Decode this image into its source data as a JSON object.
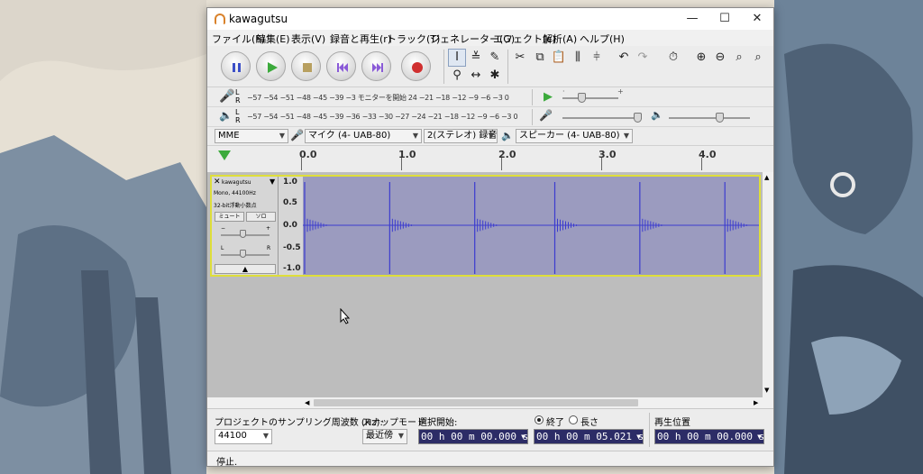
{
  "window": {
    "title": "kawagutsu"
  },
  "menu": [
    "ファイル(F)",
    "編集(E)",
    "表示(V)",
    "録音と再生(r)",
    "トラック(T)",
    "ジェネレーター(G)",
    "エフェクト(c)",
    "解析(A)",
    "ヘルプ(H)"
  ],
  "meters": {
    "record": {
      "channels": [
        "L",
        "R"
      ],
      "scale": "−57 −54 −51 −48 −45   −39 −3 モニターを開始 24 −21 −18   −12 −9  −6  −3  0"
    },
    "playback": {
      "channels": [
        "L",
        "R"
      ],
      "scale": "−57 −54 −51 −48 −45  −39 −36 −33 −30 −27 −24 −21 −18  −12 −9  −6  −3  0"
    },
    "record_volume": 0.35,
    "playback_volume": 0.95,
    "playback_speed": 0.8
  },
  "devices": {
    "host": "MME",
    "input": "マイク (4- UAB-80)",
    "channels": "2(ステレオ) 録音チ",
    "output": "スピーカー (4- UAB-80)"
  },
  "ruler": {
    "labels": [
      "0.0",
      "1.0",
      "2.0",
      "3.0",
      "4.0"
    ]
  },
  "track": {
    "name": "kawagutsu",
    "info1": "Mono, 44100Hz",
    "info2": "32-bit浮動小数点",
    "mute": "ミュート",
    "solo": "ソロ",
    "gain_minus": "−",
    "gain_plus": "+",
    "pan_left": "L",
    "pan_right": "R",
    "scale": [
      "1.0",
      "0.5",
      "0.0",
      "-0.5",
      "-1.0"
    ],
    "clicks": [
      0.0,
      0.85,
      1.7,
      2.5,
      3.35,
      4.2
    ]
  },
  "selection": {
    "rate_label": "プロジェクトのサンプリング周波数 (Hz):",
    "rate_value": "44100",
    "snap_label": "スナップモード",
    "snap_value": "最近傍",
    "start_label": "選択開始:",
    "end_label": "終了",
    "length_label": "長さ",
    "position_label": "再生位置",
    "start_value": "00 h 00 m 00.000 s",
    "end_value": "00 h 00 m 05.021 s",
    "position_value": "00 h 00 m 00.000 s"
  },
  "status": {
    "text": "停止."
  }
}
